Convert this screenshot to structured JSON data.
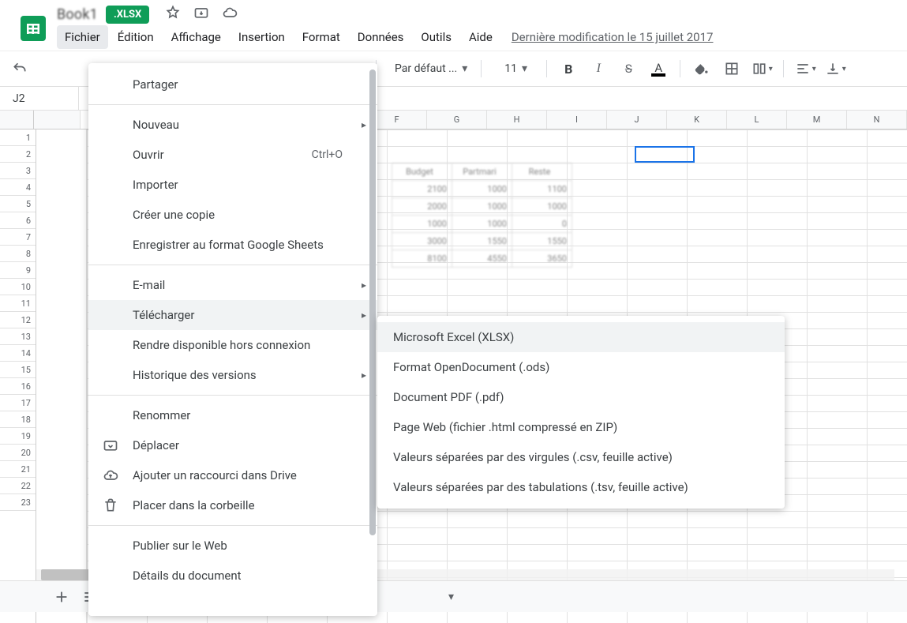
{
  "doc_title": "Book1",
  "badge": ".XLSX",
  "menubar": [
    "Fichier",
    "Édition",
    "Affichage",
    "Insertion",
    "Format",
    "Données",
    "Outils",
    "Aide"
  ],
  "active_menu_index": 0,
  "last_modified": "Dernière modification le 15 juillet 2017",
  "toolbar": {
    "font_label": "Par défaut ...",
    "font_size": "11"
  },
  "namebox": "J2",
  "columns": [
    "F",
    "G",
    "H",
    "I",
    "J",
    "K",
    "L",
    "M",
    "N"
  ],
  "row_count": 23,
  "selected_cell": {
    "col_index": 4,
    "row_index": 1
  },
  "ghost_table": {
    "headers": [
      "Budget",
      "Partmari",
      "Reste"
    ],
    "rows": [
      [
        "2100",
        "1000",
        "1100"
      ],
      [
        "2000",
        "1000",
        "1000"
      ],
      [
        "1000",
        "1000",
        "0"
      ],
      [
        "3000",
        "1550",
        "1550"
      ],
      [
        "8100",
        "4550",
        "3650"
      ]
    ]
  },
  "file_menu": {
    "groups": [
      {
        "items": [
          {
            "label": "Partager"
          }
        ]
      },
      {
        "items": [
          {
            "label": "Nouveau",
            "submenu": true
          },
          {
            "label": "Ouvrir",
            "shortcut": "Ctrl+O"
          },
          {
            "label": "Importer"
          },
          {
            "label": "Créer une copie"
          },
          {
            "label": "Enregistrer au format Google Sheets"
          }
        ]
      },
      {
        "items": [
          {
            "label": "E-mail",
            "submenu": true
          },
          {
            "label": "Télécharger",
            "submenu": true,
            "hovered": true
          },
          {
            "label": "Rendre disponible hors connexion"
          },
          {
            "label": "Historique des versions",
            "submenu": true
          }
        ]
      },
      {
        "items": [
          {
            "label": "Renommer"
          },
          {
            "label": "Déplacer",
            "icon": "move"
          },
          {
            "label": "Ajouter un raccourci dans Drive",
            "icon": "shortcut"
          },
          {
            "label": "Placer dans la corbeille",
            "icon": "trash"
          }
        ]
      },
      {
        "items": [
          {
            "label": "Publier sur le Web"
          },
          {
            "label": "Détails du document"
          }
        ]
      }
    ]
  },
  "download_submenu": [
    {
      "label": "Microsoft Excel (XLSX)",
      "hovered": true
    },
    {
      "label": "Format OpenDocument (.ods)"
    },
    {
      "label": "Document PDF (.pdf)"
    },
    {
      "label": "Page Web (fichier .html compressé en ZIP)"
    },
    {
      "label": "Valeurs séparées par des virgules (.csv, feuille active)"
    },
    {
      "label": "Valeurs séparées par des tabulations (.tsv, feuille active)"
    }
  ]
}
